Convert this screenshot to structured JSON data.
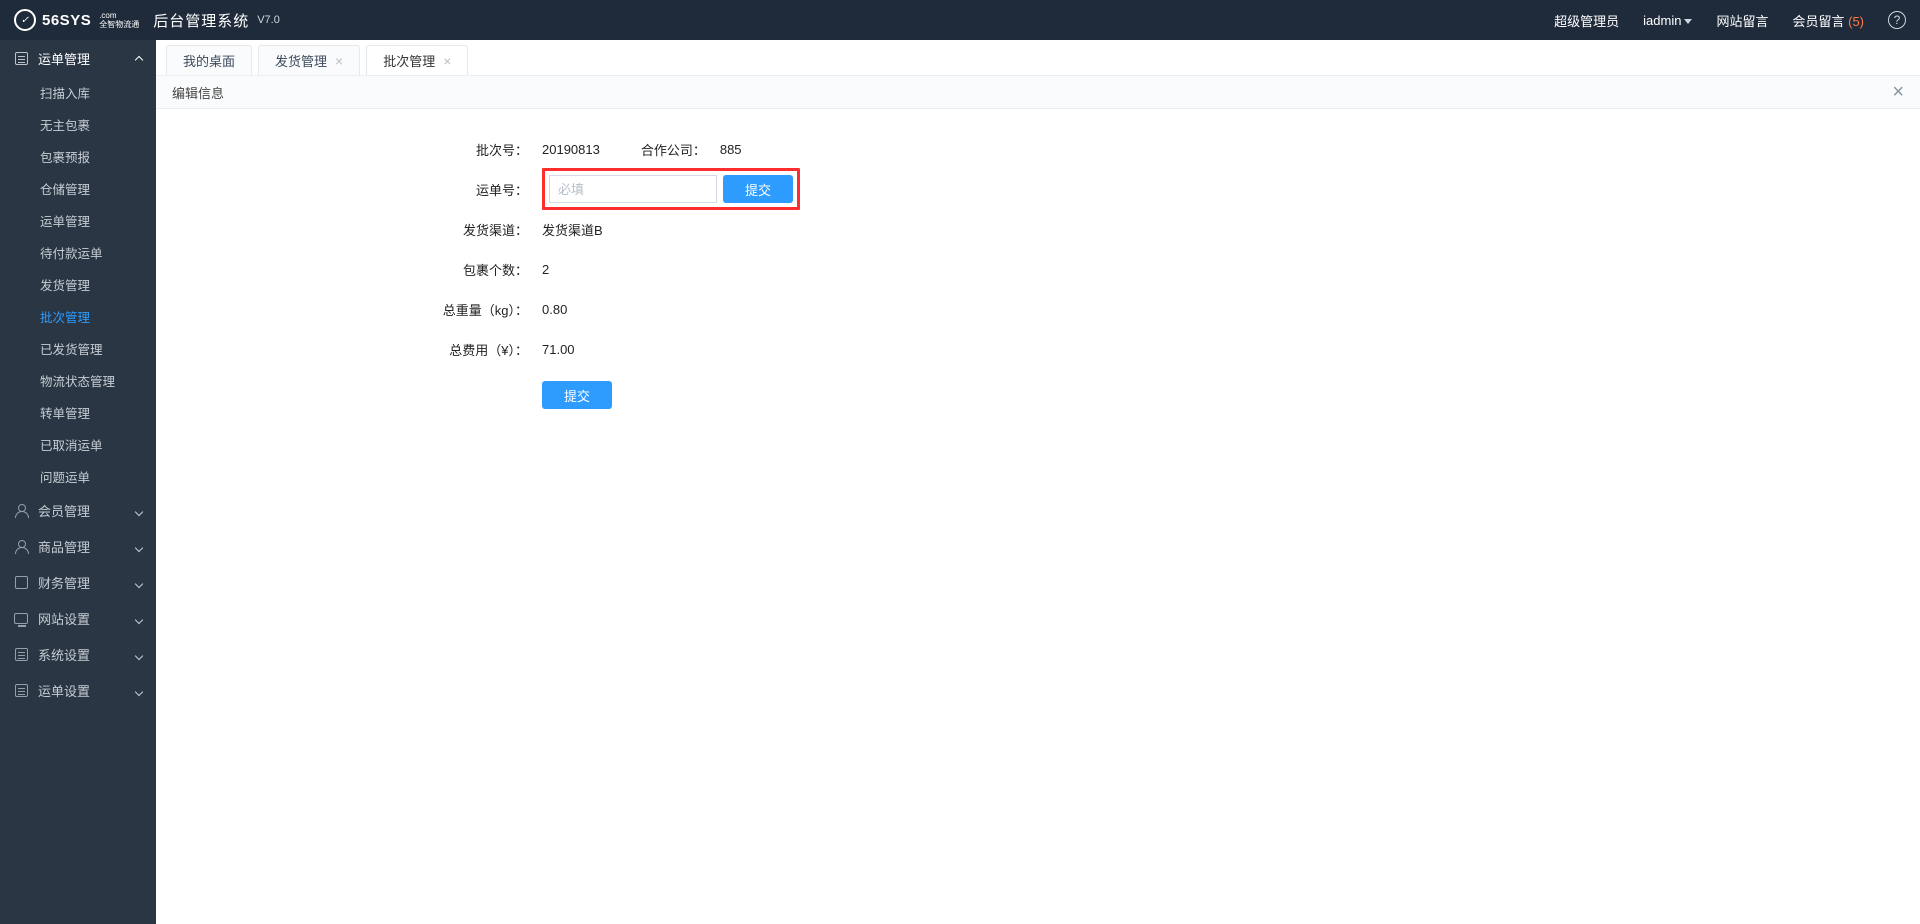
{
  "header": {
    "logo_text": "56SYS",
    "logo_suffix": ".com",
    "logo_sub": "全智物流通",
    "system_title": "后台管理系统",
    "version": "V7.0",
    "role": "超级管理员",
    "user": "iadmin",
    "site_msg": "网站留言",
    "member_msg": "会员留言",
    "member_msg_count": "(5)"
  },
  "sidebar": {
    "groups": [
      {
        "label": "运单管理",
        "expanded": true
      },
      {
        "label": "会员管理",
        "expanded": false
      },
      {
        "label": "商品管理",
        "expanded": false
      },
      {
        "label": "财务管理",
        "expanded": false
      },
      {
        "label": "网站设置",
        "expanded": false
      },
      {
        "label": "系统设置",
        "expanded": false
      },
      {
        "label": "运单设置",
        "expanded": false
      }
    ],
    "items": [
      "扫描入库",
      "无主包裹",
      "包裹预报",
      "仓储管理",
      "运单管理",
      "待付款运单",
      "发货管理",
      "批次管理",
      "已发货管理",
      "物流状态管理",
      "转单管理",
      "已取消运单",
      "问题运单"
    ],
    "selected_index": 7
  },
  "tabs": [
    {
      "label": "我的桌面",
      "closable": false
    },
    {
      "label": "发货管理",
      "closable": true
    },
    {
      "label": "批次管理",
      "closable": true,
      "active": true
    }
  ],
  "panel": {
    "title": "编辑信息"
  },
  "form": {
    "labels": {
      "batch_no": "批次号：",
      "partner": "合作公司：",
      "waybill": "运单号：",
      "channel": "发货渠道：",
      "pkg_count": "包裹个数：",
      "total_weight": "总重量（kg）：",
      "total_cost": "总费用（¥）："
    },
    "values": {
      "batch_no": "20190813",
      "partner": "885",
      "channel": "发货渠道B",
      "pkg_count": "2",
      "total_weight": "0.80",
      "total_cost": "71.00"
    },
    "waybill_placeholder": "必填",
    "submit_label": "提交"
  }
}
